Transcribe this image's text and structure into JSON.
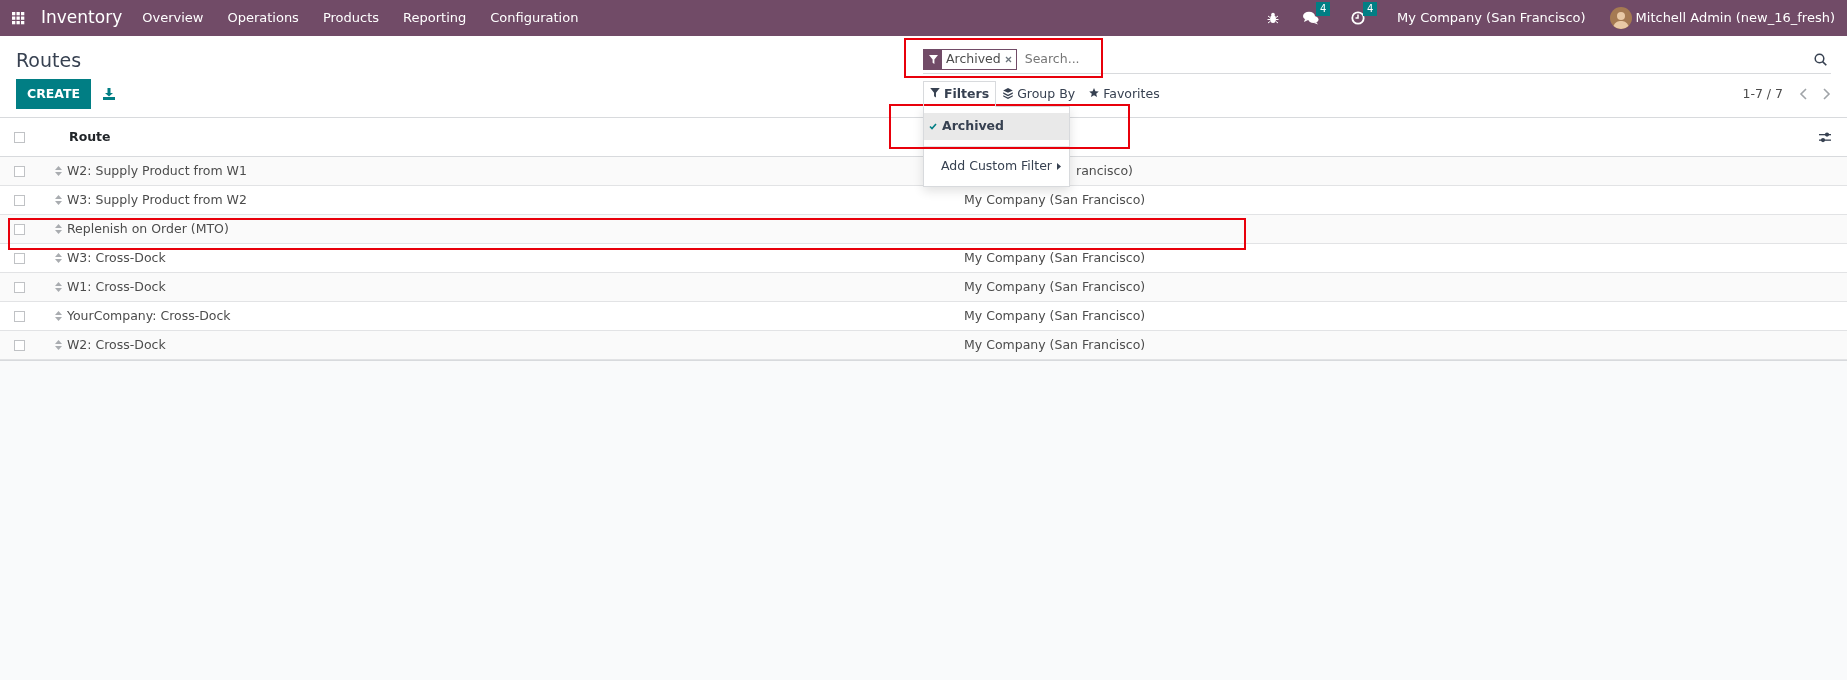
{
  "navbar": {
    "app_name": "Inventory",
    "menu": [
      "Overview",
      "Operations",
      "Products",
      "Reporting",
      "Configuration"
    ],
    "messages_count": "4",
    "activities_count": "4",
    "company": "My Company (San Francisco)",
    "user": "Mitchell Admin (new_16_fresh)"
  },
  "breadcrumb": "Routes",
  "create_label": "CREATE",
  "search": {
    "facets": [
      {
        "label": "Archived"
      }
    ],
    "placeholder": "Search...",
    "highlighted": true
  },
  "search_menus": [
    {
      "kind": "filter",
      "label": "Filters",
      "selected": true
    },
    {
      "kind": "group",
      "label": "Group By",
      "selected": false
    },
    {
      "kind": "favorite",
      "label": "Favorites",
      "selected": false
    }
  ],
  "filters_dropdown": {
    "items": [
      {
        "kind": "filter",
        "label": "Archived",
        "checked": true,
        "highlighted": true
      },
      {
        "kind": "submenu",
        "label": "Add Custom Filter"
      }
    ]
  },
  "pager": "1-7 / 7",
  "table": {
    "columns": [
      "Route"
    ],
    "select_all_checked": false,
    "rows": [
      {
        "route": "W2: Supply Product from W1",
        "company": "rancisco)",
        "partly_hidden": true,
        "checked": false
      },
      {
        "route": "W3: Supply Product from W2",
        "company": "My Company (San Francisco)",
        "checked": false
      },
      {
        "route": "Replenish on Order (MTO)",
        "highlighted": true,
        "checked": false
      },
      {
        "route": "W3: Cross-Dock",
        "company": "My Company (San Francisco)",
        "checked": false
      },
      {
        "route": "W1: Cross-Dock",
        "company": "My Company (San Francisco)",
        "checked": false
      },
      {
        "route": "YourCompany: Cross-Dock",
        "company": "My Company (San Francisco)",
        "checked": false
      },
      {
        "route": "W2: Cross-Dock",
        "company": "My Company (San Francisco)",
        "checked": false
      }
    ]
  }
}
